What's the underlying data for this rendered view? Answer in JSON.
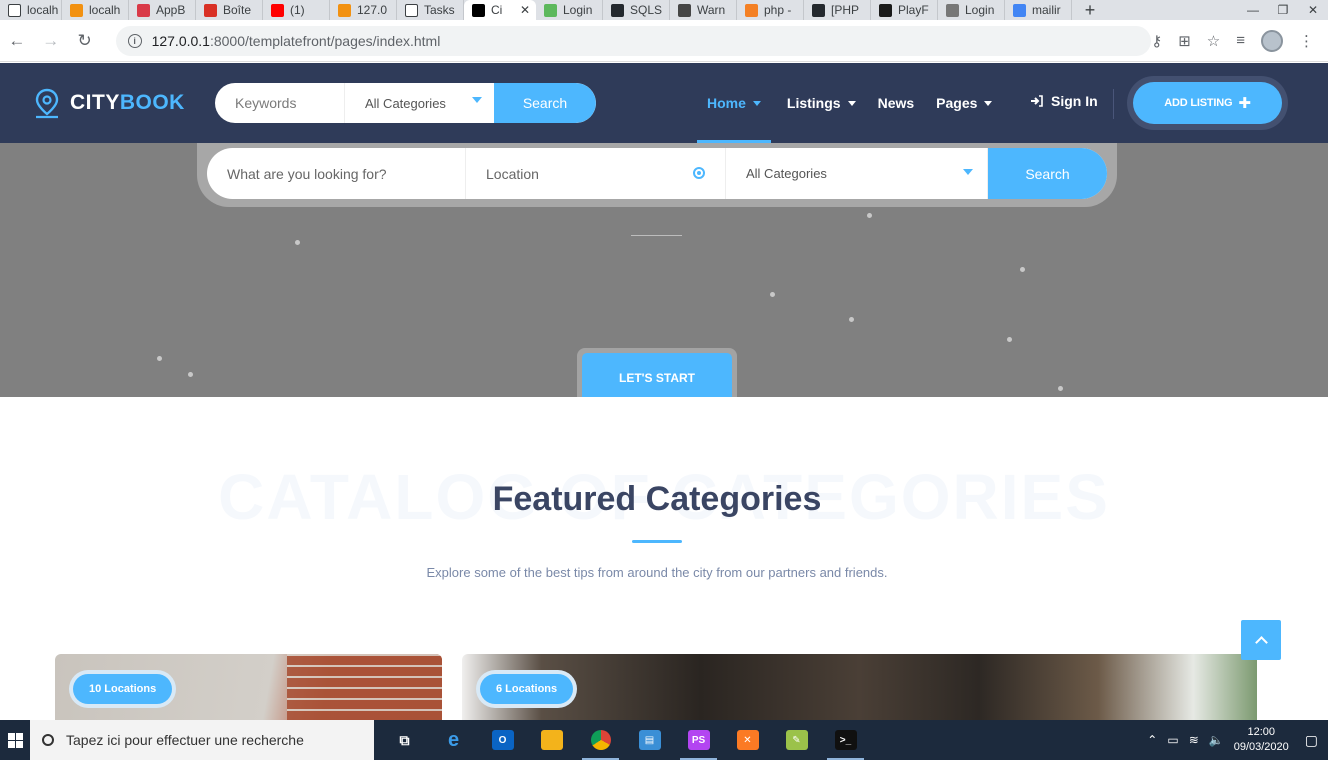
{
  "browser": {
    "tabs": [
      {
        "label": "localh",
        "favicon": "e-icon",
        "color": "#ffffff"
      },
      {
        "label": "localh",
        "favicon": "phpmyadmin-icon",
        "color": "#f29111"
      },
      {
        "label": "AppB",
        "favicon": "app-icon",
        "color": "#d93a49"
      },
      {
        "label": "Boîte",
        "favicon": "gmail-icon",
        "color": "#d93025"
      },
      {
        "label": "(1)",
        "favicon": "youtube-icon",
        "color": "#ff0000"
      },
      {
        "label": "127.0",
        "favicon": "phpmyadmin-icon",
        "color": "#f29111"
      },
      {
        "label": "Tasks",
        "favicon": "e-icon",
        "color": "#ffffff"
      },
      {
        "label": "Ci",
        "favicon": "square-icon",
        "color": "#000000",
        "active": true
      },
      {
        "label": "Login",
        "favicon": "cloud-icon",
        "color": "#5cb85c"
      },
      {
        "label": "SQLS",
        "favicon": "github-icon",
        "color": "#24292e"
      },
      {
        "label": "Warn",
        "favicon": "wordpress-icon",
        "color": "#464646"
      },
      {
        "label": "php -",
        "favicon": "stackoverflow-icon",
        "color": "#f48024"
      },
      {
        "label": "[PHP",
        "favicon": "github-icon",
        "color": "#24292e"
      },
      {
        "label": "PlayF",
        "favicon": "symfony-icon",
        "color": "#1a1a1a"
      },
      {
        "label": "Login",
        "favicon": "login-icon",
        "color": "#777777"
      },
      {
        "label": "mailir",
        "favicon": "google-icon",
        "color": "#4285f4"
      }
    ],
    "url_host": "127.0.0.1",
    "url_path": ":8000/templatefront/pages/index.html"
  },
  "header": {
    "logo_part1": "CITY",
    "logo_part2": "BOOK",
    "search": {
      "keywords_placeholder": "Keywords",
      "category_value": "All Categories",
      "button": "Search"
    },
    "nav": [
      {
        "label": "Home",
        "dropdown": true,
        "active": true
      },
      {
        "label": "Listings",
        "dropdown": true
      },
      {
        "label": "News",
        "dropdown": false
      },
      {
        "label": "Pages",
        "dropdown": true
      }
    ],
    "signin": "Sign In",
    "add_listing": "ADD LISTING"
  },
  "hero": {
    "search": {
      "what_placeholder": "What are you looking for?",
      "location_placeholder": "Location",
      "category_value": "All Categories",
      "button": "Search"
    },
    "cta": "LET'S START"
  },
  "featured": {
    "watermark": "CATALOG OF CATEGORIES",
    "title": "Featured Categories",
    "subtitle": "Explore some of the best tips from around the city from our partners and friends.",
    "cards": [
      {
        "badge": "10 Locations"
      },
      {
        "badge": "6 Locations"
      }
    ]
  },
  "taskbar": {
    "search_placeholder": "Tapez ici pour effectuer une recherche",
    "time": "12:00",
    "date": "09/03/2020",
    "apps": [
      {
        "name": "task-view-icon",
        "color": "#1c2a3d",
        "glyph": "⧉"
      },
      {
        "name": "edge-icon",
        "color": "#0078d7",
        "glyph": "e"
      },
      {
        "name": "outlook-icon",
        "color": "#0a64c4",
        "glyph": "O"
      },
      {
        "name": "file-explorer-icon",
        "color": "#f3b31b",
        "glyph": ""
      },
      {
        "name": "chrome-icon",
        "color": "#db4437",
        "glyph": "",
        "open": true
      },
      {
        "name": "control-panel-icon",
        "color": "#3a8fd6",
        "glyph": "▤"
      },
      {
        "name": "phpstorm-icon",
        "color": "#b345f1",
        "glyph": "PS",
        "open": true
      },
      {
        "name": "xampp-icon",
        "color": "#fb7a24",
        "glyph": "✕"
      },
      {
        "name": "notepad-icon",
        "color": "#9bc24a",
        "glyph": "✎"
      },
      {
        "name": "terminal-icon",
        "color": "#101010",
        "glyph": ">_",
        "open": true
      }
    ]
  }
}
